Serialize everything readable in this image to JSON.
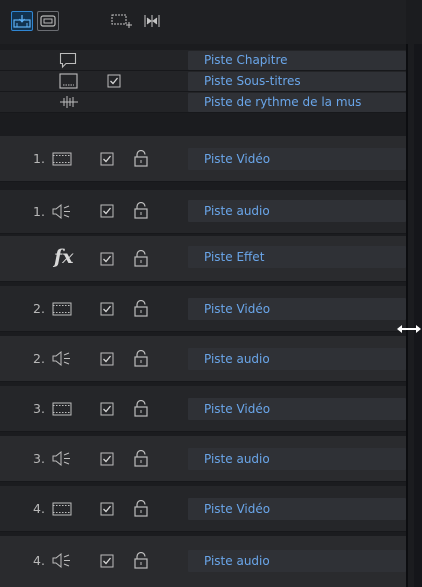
{
  "toolbar": {
    "buttons": [
      {
        "name": "track-view-icon",
        "state": "active"
      },
      {
        "name": "screen-icon",
        "state": "boxed"
      },
      {
        "name": "add-track-icon",
        "state": "normal"
      },
      {
        "name": "fit-tracks-icon",
        "state": "normal"
      }
    ]
  },
  "tracks": [
    {
      "type": "chapter",
      "label": "Piste Chapitre"
    },
    {
      "type": "subtitle",
      "label": "Piste Sous-titres"
    },
    {
      "type": "rhythm",
      "label": "Piste de rythme de la mus"
    },
    {
      "type": "video",
      "number": "1.",
      "label": "Piste Vidéo"
    },
    {
      "type": "audio",
      "number": "1.",
      "label": "Piste audio"
    },
    {
      "type": "effect",
      "fx": "fx",
      "label": "Piste Effet"
    },
    {
      "type": "video",
      "number": "2.",
      "label": "Piste Vidéo"
    },
    {
      "type": "audio",
      "number": "2.",
      "label": "Piste audio"
    },
    {
      "type": "video",
      "number": "3.",
      "label": "Piste Vidéo"
    },
    {
      "type": "audio",
      "number": "3.",
      "label": "Piste audio"
    },
    {
      "type": "video",
      "number": "4.",
      "label": "Piste Vidéo"
    },
    {
      "type": "audio",
      "number": "4.",
      "label": "Piste audio"
    }
  ],
  "colors": {
    "accent": "#2f86d3",
    "label_text": "#6aa6ea",
    "label_bg": "#2f3136"
  }
}
